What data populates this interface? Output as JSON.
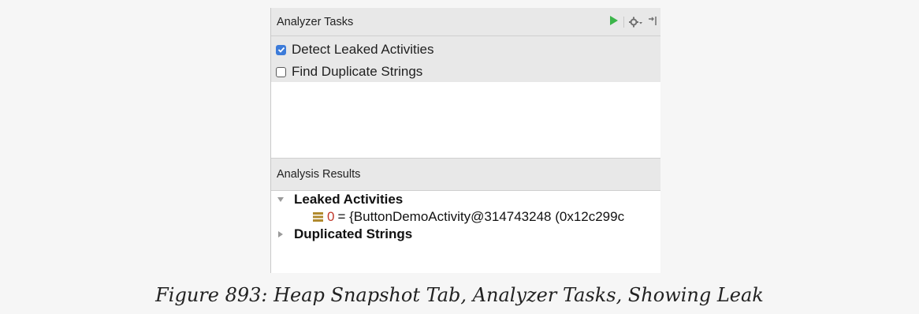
{
  "analyzer_tasks": {
    "title": "Analyzer Tasks",
    "toolbar": {
      "run_icon": "play-icon",
      "settings_icon": "gear-icon",
      "hide_icon": "hide-panel-icon"
    },
    "tasks": [
      {
        "label": "Detect Leaked Activities",
        "checked": true
      },
      {
        "label": "Find Duplicate Strings",
        "checked": false
      }
    ]
  },
  "analysis_results": {
    "title": "Analysis Results",
    "groups": [
      {
        "label": "Leaked Activities",
        "expanded": true,
        "items": [
          {
            "index": "0",
            "text": "= {ButtonDemoActivity@314743248 (0x12c299c"
          }
        ]
      },
      {
        "label": "Duplicated Strings",
        "expanded": false
      }
    ]
  },
  "caption": "Figure 893: Heap Snapshot Tab, Analyzer Tasks, Showing Leak",
  "colors": {
    "run": "#3bb54a",
    "checkbox": "#3c7bd9",
    "index": "#c0392b",
    "field_icon": "#b08a2e"
  }
}
